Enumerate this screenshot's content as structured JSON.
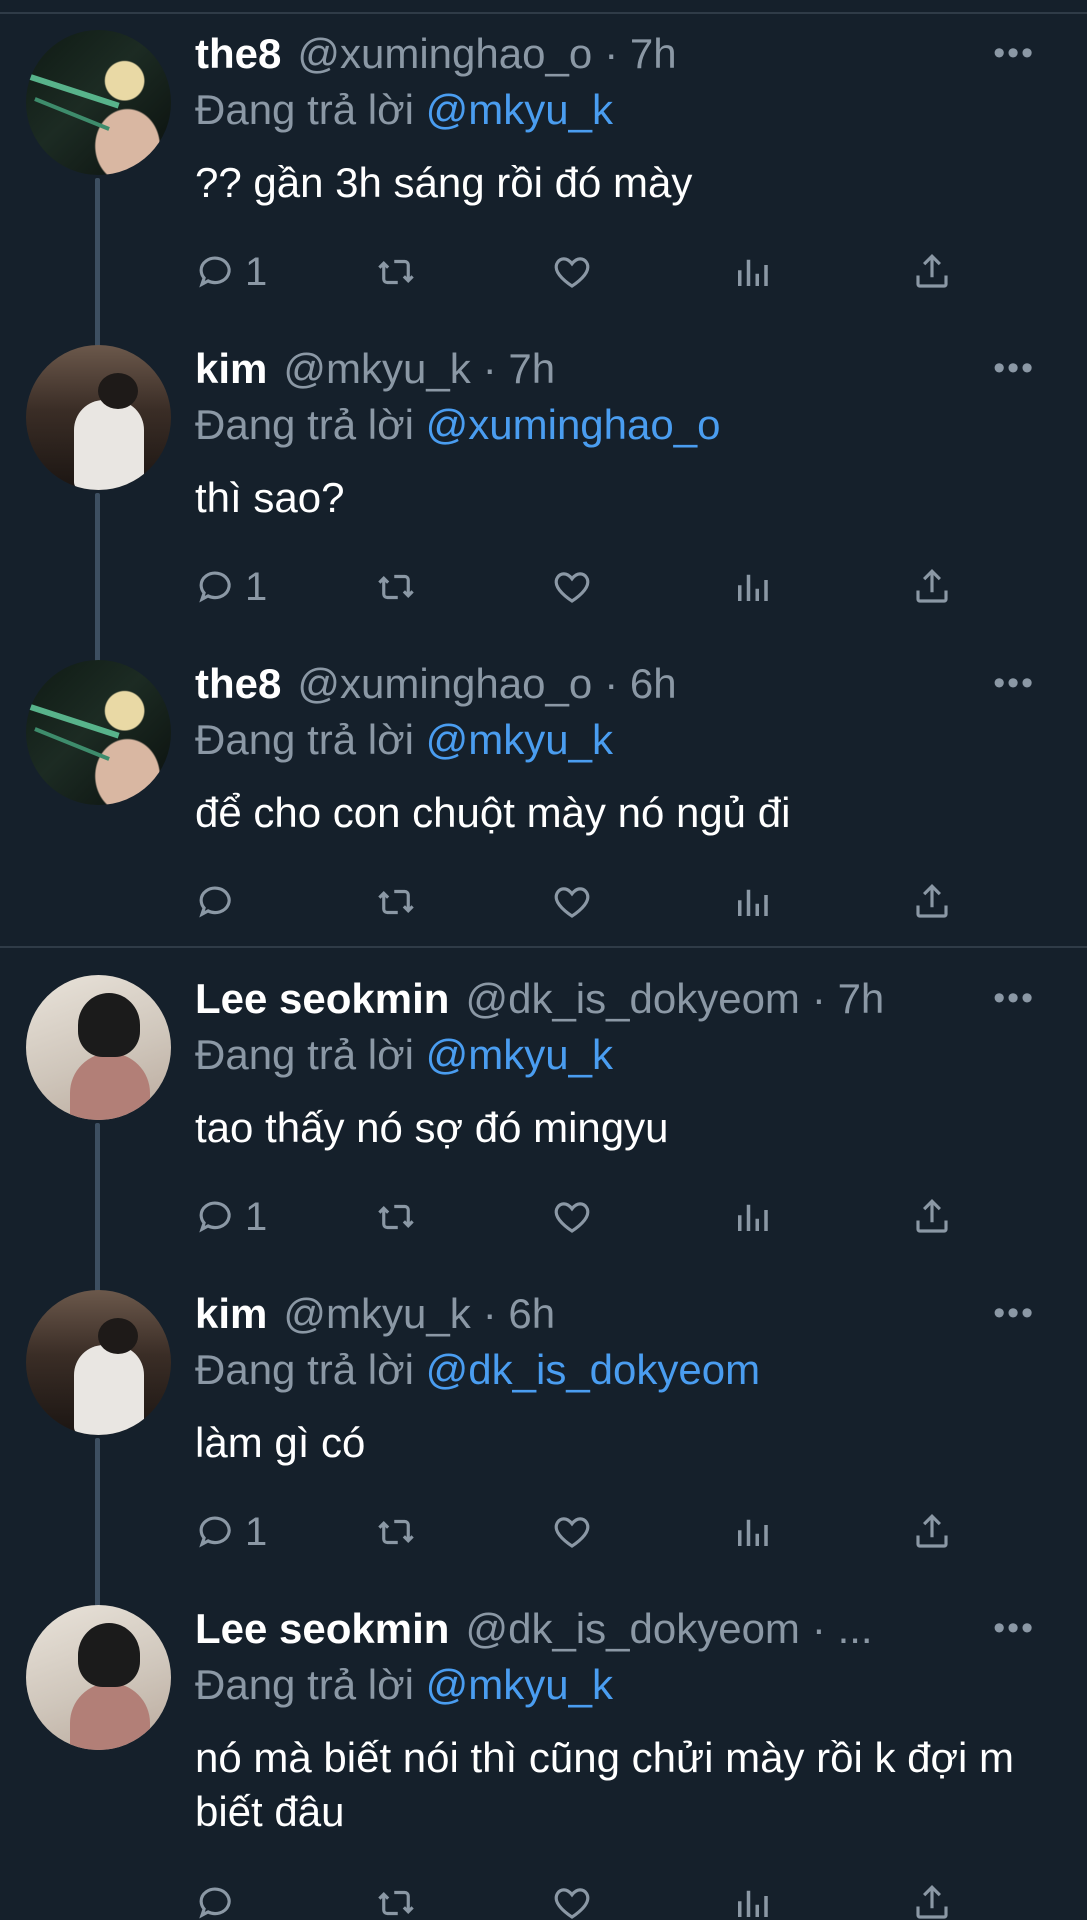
{
  "tweets": [
    {
      "name": "the8",
      "handle": "@xuminghao_o",
      "time": "· 7h",
      "reply_prefix": "Đang trả lời",
      "reply_to": "@mkyu_k",
      "text": "?? gần 3h sáng rồi đó mày",
      "reply_count": "1"
    },
    {
      "name": "kim",
      "handle": "@mkyu_k",
      "time": "· 7h",
      "reply_prefix": "Đang trả lời",
      "reply_to": "@xuminghao_o",
      "text": "thì sao?",
      "reply_count": "1"
    },
    {
      "name": "the8",
      "handle": "@xuminghao_o",
      "time": "· 6h",
      "reply_prefix": "Đang trả lời",
      "reply_to": "@mkyu_k",
      "text": "để cho con chuột mày nó ngủ đi",
      "reply_count": ""
    },
    {
      "name": "Lee seokmin",
      "handle": "@dk_is_dokyeom",
      "time": "· 7h",
      "reply_prefix": "Đang trả lời",
      "reply_to": "@mkyu_k",
      "text": "tao thấy nó sợ đó mingyu",
      "reply_count": "1"
    },
    {
      "name": "kim",
      "handle": "@mkyu_k",
      "time": "· 6h",
      "reply_prefix": "Đang trả lời",
      "reply_to": "@dk_is_dokyeom",
      "text": "làm gì có",
      "reply_count": "1"
    },
    {
      "name": "Lee seokmin",
      "handle": "@dk_is_dokyeom",
      "time": "· ...",
      "reply_prefix": "Đang trả lời",
      "reply_to": "@mkyu_k",
      "text": "nó mà biết nói thì cũng chửi mày rồi k đợi m biết đâu",
      "reply_count": ""
    }
  ],
  "icons": {
    "more": "more-horizontal-icon",
    "reply": "reply-bubble-icon",
    "retweet": "retweet-icon",
    "like": "heart-icon",
    "views": "views-bar-chart-icon",
    "share": "share-upload-icon"
  },
  "more_glyph": "•••",
  "colors": {
    "background": "#15202b",
    "secondary_text": "#8b98a5",
    "mention": "#4a9df0",
    "divider": "#2f3b47"
  }
}
